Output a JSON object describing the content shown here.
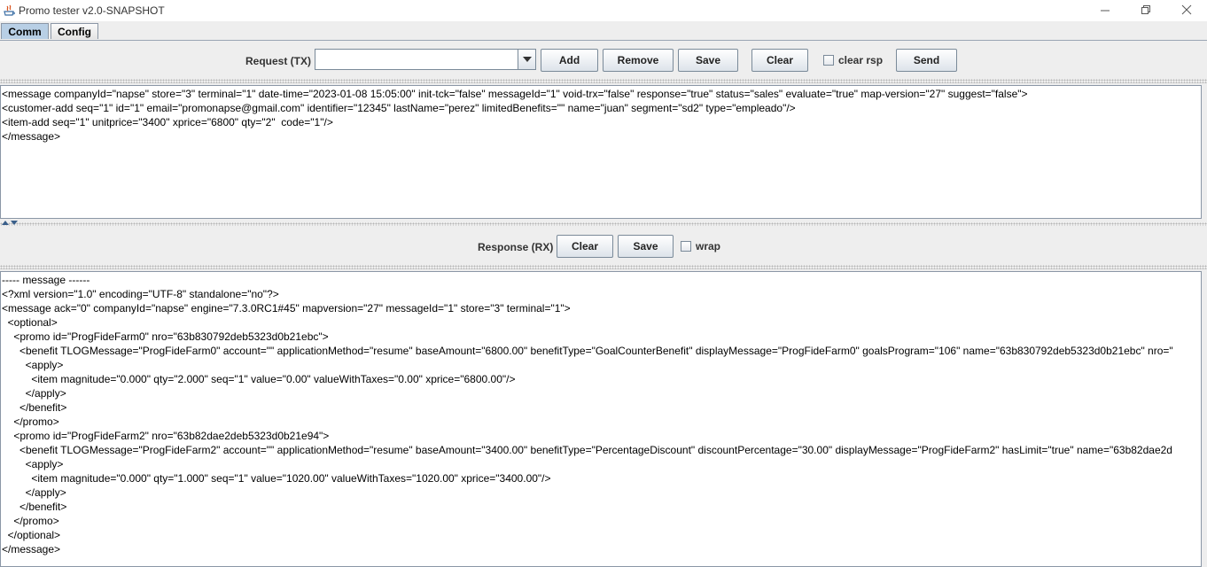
{
  "window": {
    "title": "Promo tester v2.0-SNAPSHOT"
  },
  "tabs": [
    {
      "label": "Comm",
      "active": true
    },
    {
      "label": "Config",
      "active": false
    }
  ],
  "request": {
    "label": "Request (TX)",
    "combo_value": "",
    "buttons": {
      "add": "Add",
      "remove": "Remove",
      "save": "Save",
      "clear": "Clear",
      "send": "Send"
    },
    "clear_rsp_label": "clear rsp",
    "clear_rsp_checked": false,
    "lines": [
      "<message companyId=\"napse\" store=\"3\" terminal=\"1\" date-time=\"2023-01-08 15:05:00\" init-tck=\"false\" messageId=\"1\" void-trx=\"false\" response=\"true\" status=\"sales\" evaluate=\"true\" map-version=\"27\" suggest=\"false\">",
      "<customer-add seq=\"1\" id=\"1\" email=\"promonapse@gmail.com\" identifier=\"12345\" lastName=\"perez\" limitedBenefits=\"\" name=\"juan\" segment=\"sd2\" type=\"empleado\"/>",
      "<item-add seq=\"1\" unitprice=\"3400\" xprice=\"6800\" qty=\"2\"  code=\"1\"/>",
      "</message>"
    ]
  },
  "response": {
    "label": "Response (RX)",
    "buttons": {
      "clear": "Clear",
      "save": "Save"
    },
    "wrap_label": "wrap",
    "wrap_checked": false,
    "lines": [
      "----- message ------",
      "<?xml version=\"1.0\" encoding=\"UTF-8\" standalone=\"no\"?>",
      "<message ack=\"0\" companyId=\"napse\" engine=\"7.3.0RC1#45\" mapversion=\"27\" messageId=\"1\" store=\"3\" terminal=\"1\">",
      "  <optional>",
      "    <promo id=\"ProgFideFarm0\" nro=\"63b830792deb5323d0b21ebc\">",
      "      <benefit TLOGMessage=\"ProgFideFarm0\" account=\"\" applicationMethod=\"resume\" baseAmount=\"6800.00\" benefitType=\"GoalCounterBenefit\" displayMessage=\"ProgFideFarm0\" goalsProgram=\"106\" name=\"63b830792deb5323d0b21ebc\" nro=\"",
      "        <apply>",
      "          <item magnitude=\"0.000\" qty=\"2.000\" seq=\"1\" value=\"0.00\" valueWithTaxes=\"0.00\" xprice=\"6800.00\"/>",
      "        </apply>",
      "      </benefit>",
      "    </promo>",
      "    <promo id=\"ProgFideFarm2\" nro=\"63b82dae2deb5323d0b21e94\">",
      "      <benefit TLOGMessage=\"ProgFideFarm2\" account=\"\" applicationMethod=\"resume\" baseAmount=\"3400.00\" benefitType=\"PercentageDiscount\" discountPercentage=\"30.00\" displayMessage=\"ProgFideFarm2\" hasLimit=\"true\" name=\"63b82dae2d",
      "        <apply>",
      "          <item magnitude=\"0.000\" qty=\"1.000\" seq=\"1\" value=\"1020.00\" valueWithTaxes=\"1020.00\" xprice=\"3400.00\"/>",
      "        </apply>",
      "      </benefit>",
      "    </promo>",
      "  </optional>",
      "</message>"
    ]
  }
}
